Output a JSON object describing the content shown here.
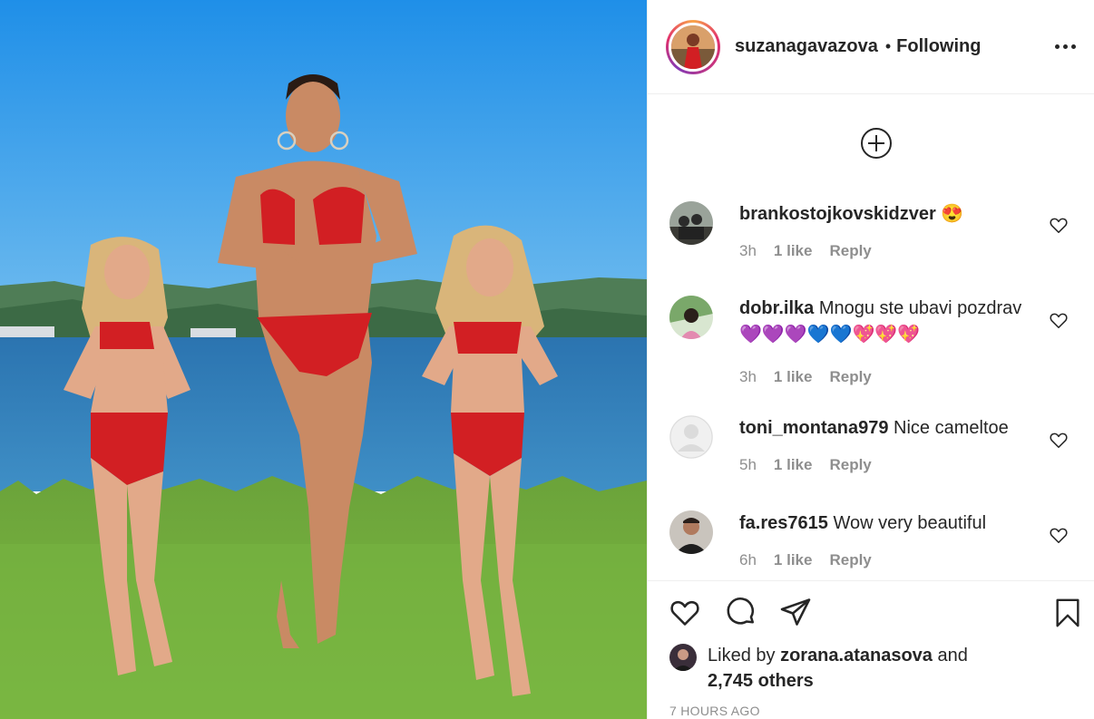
{
  "post": {
    "username": "suzanagavazova",
    "separator": "•",
    "follow_status": "Following"
  },
  "comments": [
    {
      "user": "brankostojkovskidzver",
      "text": "😍",
      "time": "3h",
      "likes": "1 like",
      "reply": "Reply"
    },
    {
      "user": "dobr.ilka",
      "text": "Mnogu ste ubavi pozdrav 💜💜💜💙💙💖💖💖",
      "time": "3h",
      "likes": "1 like",
      "reply": "Reply"
    },
    {
      "user": "toni_montana979",
      "text": "Nice cameltoe",
      "time": "5h",
      "likes": "1 like",
      "reply": "Reply"
    },
    {
      "user": "fa.res7615",
      "text": "Wow very beautiful",
      "time": "6h",
      "likes": "1 like",
      "reply": "Reply"
    }
  ],
  "likes": {
    "prefix": "Liked by",
    "user": "zorana.atanasova",
    "suffix": "and",
    "others": "2,745 others"
  },
  "timestamp": "7 HOURS AGO",
  "icons": {
    "more": "more-options-icon",
    "load_more": "plus-circle-icon",
    "like": "heart-icon",
    "comment": "comment-bubble-icon",
    "share": "paper-plane-icon",
    "save": "bookmark-icon"
  },
  "colors": {
    "text": "#262626",
    "muted": "#8e8e8e",
    "border": "#efefef"
  }
}
